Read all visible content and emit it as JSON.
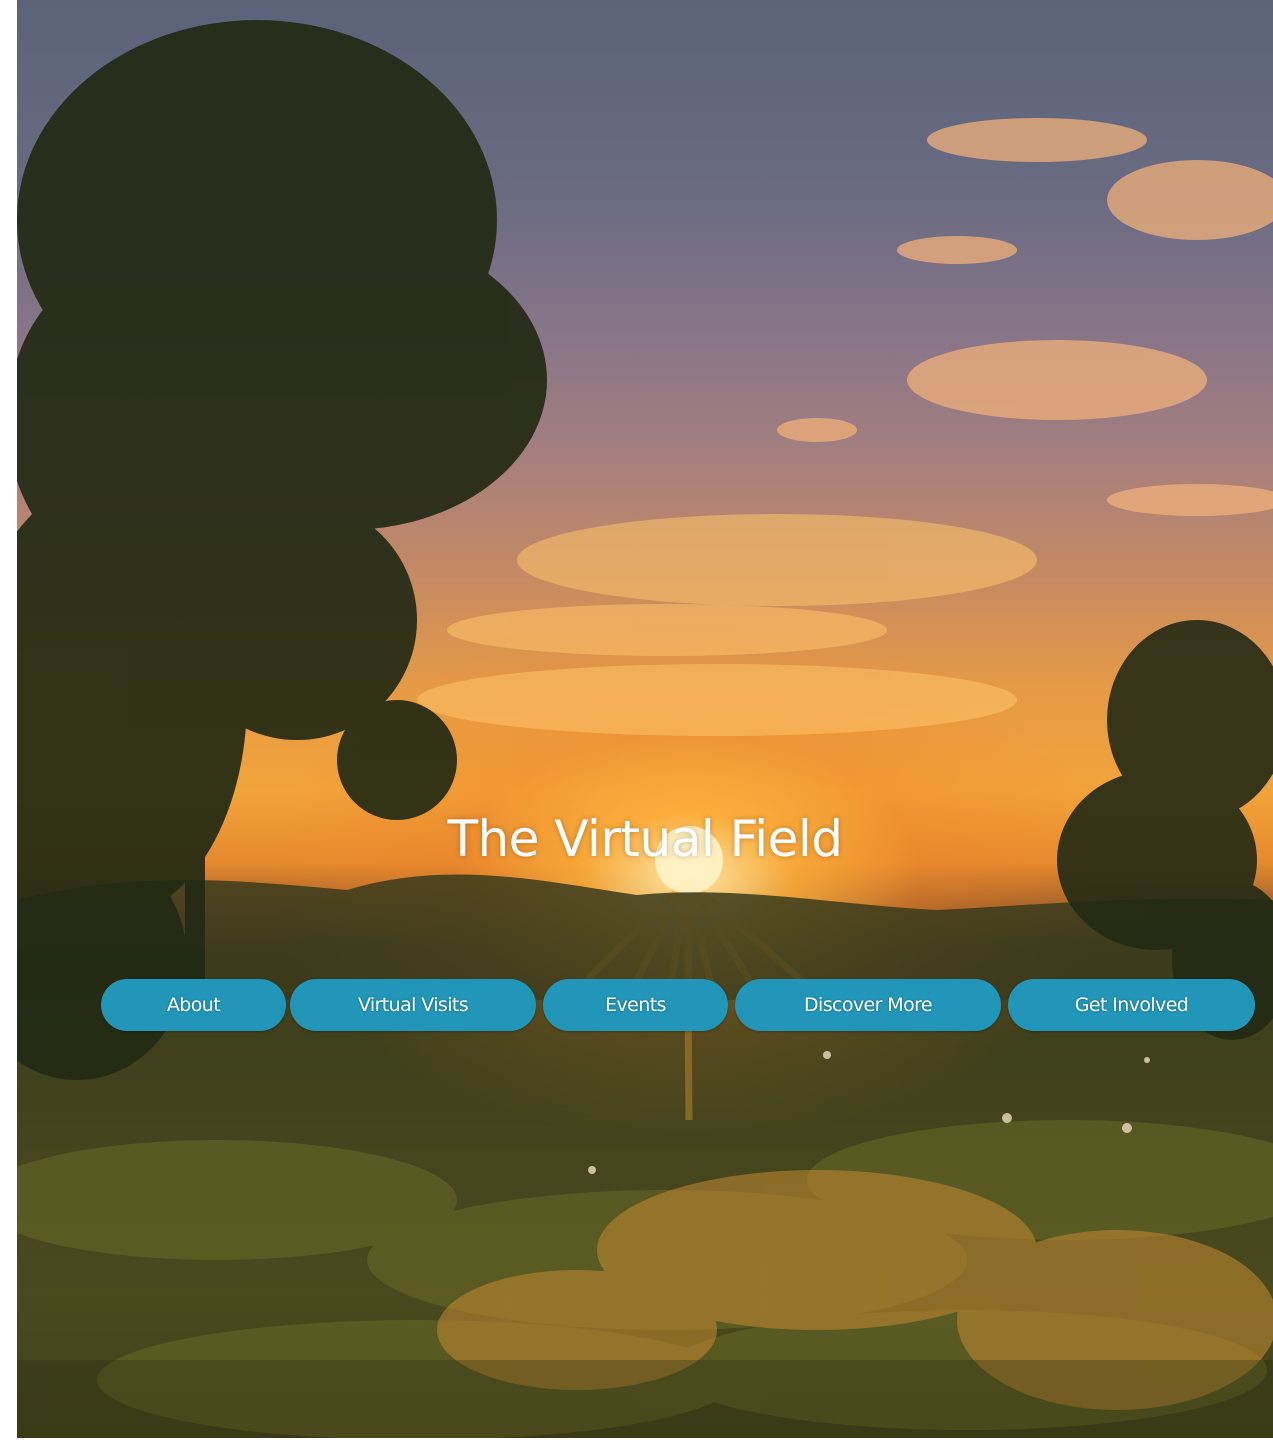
{
  "hero": {
    "title": "The Virtual Field",
    "image": "sunset-over-meadow-with-trees"
  },
  "nav": {
    "items": [
      {
        "label": "About"
      },
      {
        "label": "Virtual Visits"
      },
      {
        "label": "Events"
      },
      {
        "label": "Discover More"
      },
      {
        "label": "Get Involved"
      }
    ]
  },
  "colors": {
    "button_background": "#2196b9",
    "button_text": "#ffffff",
    "title_text": "#ffffff"
  }
}
